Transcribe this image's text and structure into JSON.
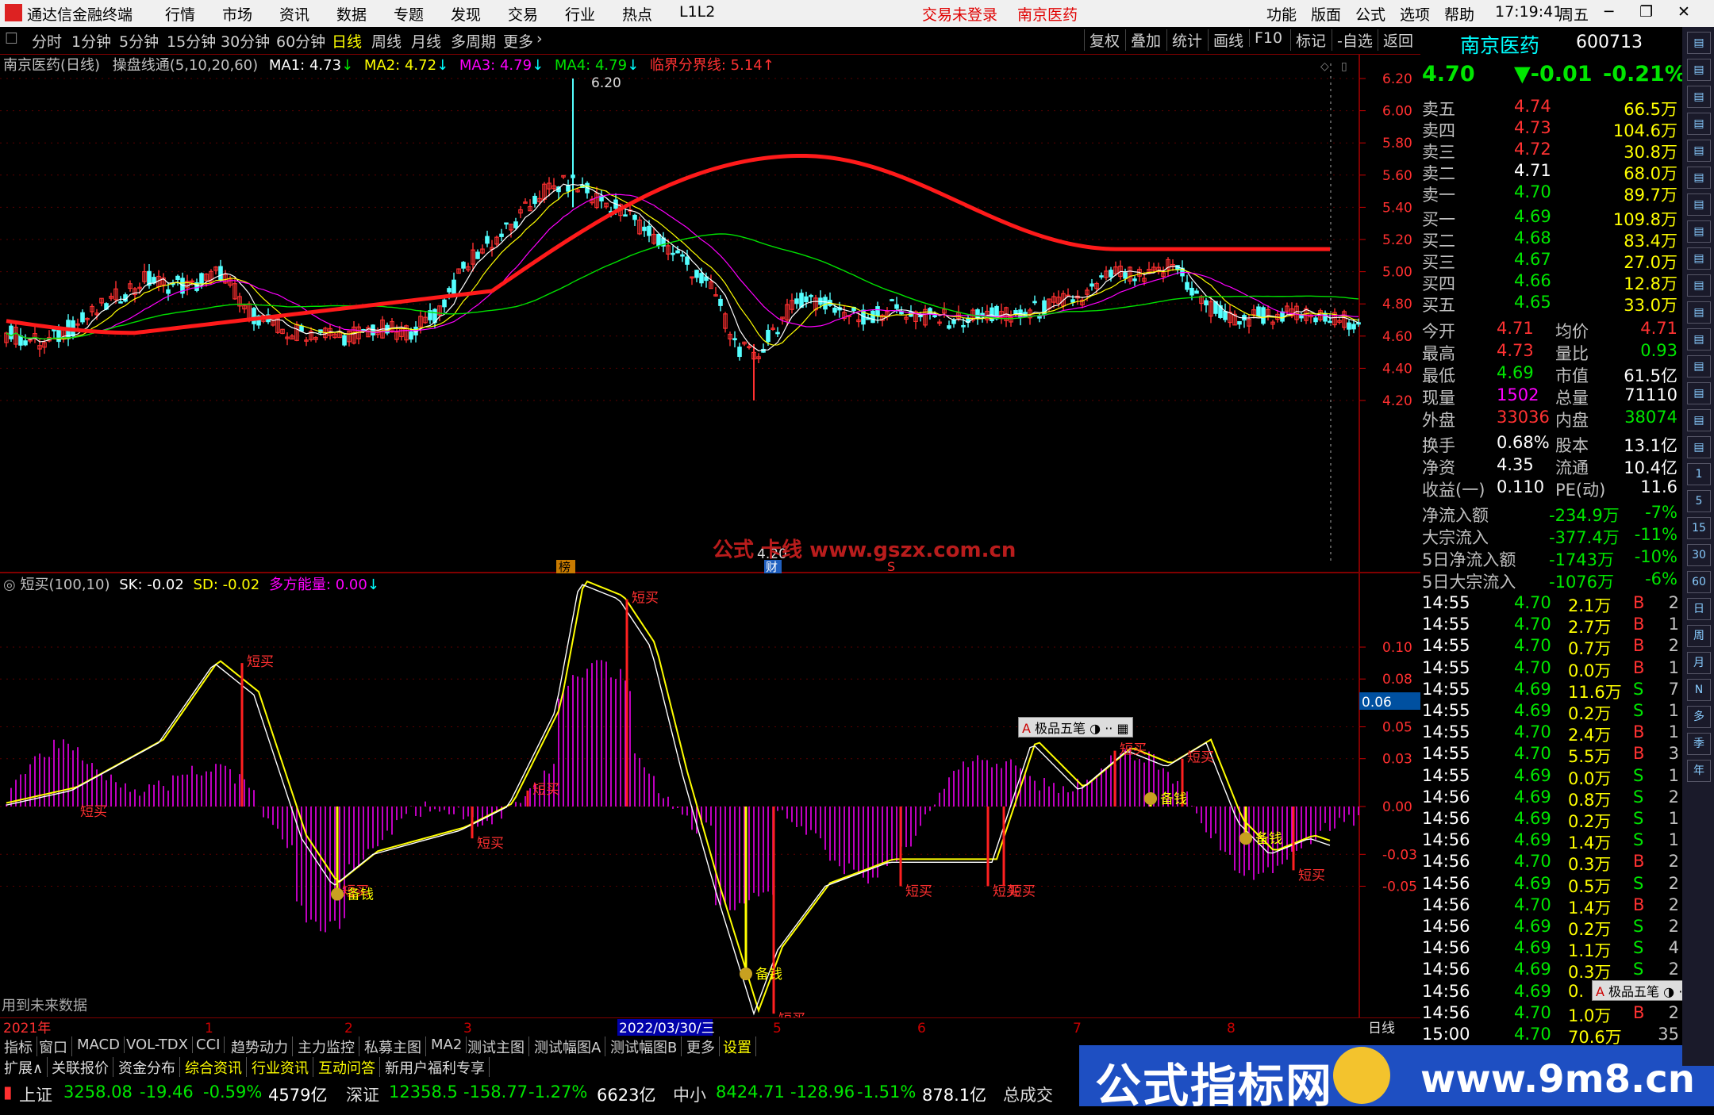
{
  "menu": {
    "app_title": "通达信金融终端",
    "items": [
      "行情",
      "市场",
      "资讯",
      "数据",
      "专题",
      "发现",
      "交易",
      "行业",
      "热点",
      "L1L2"
    ],
    "trade_status": "交易未登录",
    "stock_name_tag": "南京医药",
    "right_items": [
      "功能",
      "版面",
      "公式",
      "选项",
      "帮助"
    ],
    "time": "17:19:41",
    "weekday": "周五"
  },
  "tabs": {
    "periods": [
      "分时",
      "1分钟",
      "5分钟",
      "15分钟",
      "30分钟",
      "60分钟",
      "日线",
      "周线",
      "月线",
      "多周期",
      "更多"
    ],
    "active": "日线",
    "right_buttons": [
      "复权",
      "叠加",
      "统计",
      "画线",
      "F10",
      "标记",
      "-自选",
      "返回"
    ]
  },
  "legend_main": {
    "title": "南京医药(日线)",
    "indicator": "操盘线通",
    "params": "(5,10,20,60)",
    "ma1": "MA1: 4.73",
    "ma2": "MA2: 4.72",
    "ma3": "MA3: 4.79",
    "ma4": "MA4: 4.79",
    "critical": "临界分界线: 5.14"
  },
  "main_axis": [
    "6.20",
    "6.00",
    "5.80",
    "5.60",
    "5.40",
    "5.20",
    "5.00",
    "4.80",
    "4.60",
    "4.40",
    "4.20"
  ],
  "main_annotations": {
    "high_label": "6.20",
    "low_label": "4.20",
    "watermark": "公式 卡线  www.gszx.com.cn",
    "marker_bang": "榜",
    "marker_cai": "财",
    "marker_s": "S"
  },
  "legend_sub": {
    "title": "短买(100,10)",
    "sk": "SK: -0.02",
    "sd": "SD: -0.02",
    "energy": "多方能量: 0.00"
  },
  "sub_axis": [
    "0.10",
    "0.08",
    "0.05",
    "0.03",
    "0.00",
    "-0.03",
    "-0.05"
  ],
  "sub_current": "0.06",
  "sub_labels": {
    "buy": "短买",
    "reserve": "备钱"
  },
  "sub_footer": "用到未来数据",
  "popup_label": "极品五笔",
  "x_axis": {
    "year": "2021年",
    "months": [
      "1",
      "2",
      "3",
      "4",
      "5",
      "6",
      "7",
      "8"
    ],
    "selected_date": "2022/03/30/三",
    "period": "日线"
  },
  "quote": {
    "name": "南京医药",
    "code": "600713",
    "price": "4.70",
    "change": "▼-0.01",
    "pct": "-0.21%",
    "asks": [
      {
        "label": "卖五",
        "price": "4.74",
        "vol": "66.5万"
      },
      {
        "label": "卖四",
        "price": "4.73",
        "vol": "104.6万"
      },
      {
        "label": "卖三",
        "price": "4.72",
        "vol": "30.8万"
      },
      {
        "label": "卖二",
        "price": "4.71",
        "vol": "68.0万"
      },
      {
        "label": "卖一",
        "price": "4.70",
        "vol": "89.7万"
      }
    ],
    "bids": [
      {
        "label": "买一",
        "price": "4.69",
        "vol": "109.8万"
      },
      {
        "label": "买二",
        "price": "4.68",
        "vol": "83.4万"
      },
      {
        "label": "买三",
        "price": "4.67",
        "vol": "27.0万"
      },
      {
        "label": "买四",
        "price": "4.66",
        "vol": "12.8万"
      },
      {
        "label": "买五",
        "price": "4.65",
        "vol": "33.0万"
      }
    ],
    "stats": [
      {
        "l1": "今开",
        "v1": "4.71",
        "l2": "均价",
        "v2": "4.71"
      },
      {
        "l1": "最高",
        "v1": "4.73",
        "l2": "量比",
        "v2": "0.93"
      },
      {
        "l1": "最低",
        "v1": "4.69",
        "l2": "市值",
        "v2": "61.5亿"
      },
      {
        "l1": "现量",
        "v1": "1502",
        "l2": "总量",
        "v2": "71110"
      },
      {
        "l1": "外盘",
        "v1": "33036",
        "l2": "内盘",
        "v2": "38074"
      }
    ],
    "fund": [
      {
        "l1": "换手",
        "v1": "0.68%",
        "l2": "股本",
        "v2": "13.1亿"
      },
      {
        "l1": "净资",
        "v1": "4.35",
        "l2": "流通",
        "v2": "10.4亿"
      },
      {
        "l1": "收益(一)",
        "v1": "0.110",
        "l2": "PE(动)",
        "v2": "11.6"
      }
    ],
    "flows": [
      {
        "label": "净流入额",
        "value": "-234.9万",
        "pct": "-7%"
      },
      {
        "label": "大宗流入",
        "value": "-377.4万",
        "pct": "-11%"
      },
      {
        "label": "5日净流入额",
        "value": "-1743万",
        "pct": "-10%"
      },
      {
        "label": "5日大宗流入",
        "value": "-1076万",
        "pct": "-6%"
      }
    ],
    "ticks": [
      [
        "14:55",
        "4.70",
        "2.1万",
        "B",
        "2"
      ],
      [
        "14:55",
        "4.70",
        "2.7万",
        "B",
        "1"
      ],
      [
        "14:55",
        "4.70",
        "0.7万",
        "B",
        "2"
      ],
      [
        "14:55",
        "4.70",
        "0.0万",
        "B",
        "1"
      ],
      [
        "14:55",
        "4.69",
        "11.6万",
        "S",
        "7"
      ],
      [
        "14:55",
        "4.69",
        "0.2万",
        "S",
        "1"
      ],
      [
        "14:55",
        "4.70",
        "2.4万",
        "B",
        "1"
      ],
      [
        "14:55",
        "4.70",
        "5.5万",
        "B",
        "3"
      ],
      [
        "14:55",
        "4.69",
        "0.0万",
        "S",
        "1"
      ],
      [
        "14:56",
        "4.69",
        "0.8万",
        "S",
        "2"
      ],
      [
        "14:56",
        "4.69",
        "0.2万",
        "S",
        "1"
      ],
      [
        "14:56",
        "4.69",
        "1.4万",
        "S",
        "1"
      ],
      [
        "14:56",
        "4.70",
        "0.3万",
        "B",
        "2"
      ],
      [
        "14:56",
        "4.69",
        "0.5万",
        "S",
        "2"
      ],
      [
        "14:56",
        "4.70",
        "1.4万",
        "B",
        "2"
      ],
      [
        "14:56",
        "4.69",
        "0.2万",
        "S",
        "2"
      ],
      [
        "14:56",
        "4.69",
        "1.1万",
        "S",
        "4"
      ],
      [
        "14:56",
        "4.69",
        "0.3万",
        "S",
        "2"
      ],
      [
        "14:56",
        "4.69",
        "0.",
        "",
        ""
      ],
      [
        "14:56",
        "4.70",
        "1.0万",
        "B",
        "2"
      ],
      [
        "15:00",
        "4.70",
        "70.6万",
        "",
        "35"
      ]
    ]
  },
  "right_tool_labels": [
    "1",
    "5",
    "15",
    "30",
    "60",
    "日",
    "周",
    "月",
    "N",
    "多",
    "季",
    "年"
  ],
  "bottom_tabs": [
    "指标",
    "窗口",
    "MACD",
    "VOL-TDX",
    "CCI",
    "趋势动力",
    "主力监控",
    "私募主图",
    "MA2",
    "测试主图",
    "测试幅图A",
    "测试幅图B",
    "更多",
    "设置"
  ],
  "bottom_tabs2": [
    "扩展∧",
    "关联报价",
    "资金分布",
    "综合资讯",
    "行业资讯",
    "互动问答",
    "新用户福利专享"
  ],
  "status": {
    "sh_label": "上证",
    "sh_val": "3258.08",
    "sh_chg": "-19.46",
    "sh_pct": "-0.59%",
    "sh_amt": "4579亿",
    "sz_label": "深证",
    "sz_val": "12358.5",
    "sz_chg": "-158.77",
    "sz_pct": "-1.27%",
    "sz_amt": "6623亿",
    "zx_label": "中小",
    "zx_val": "8424.71",
    "zx_chg": "-128.96",
    "zx_pct": "-1.51%",
    "zx_amt": "878.1亿",
    "total_label": "总成交"
  },
  "brand": {
    "name": "公式指标网",
    "url": "www.9m8.cn"
  }
}
